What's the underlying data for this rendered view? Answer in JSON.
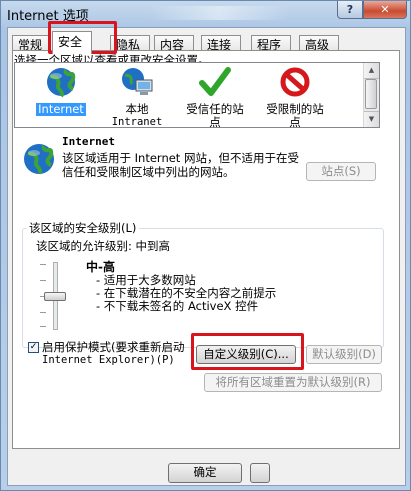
{
  "window": {
    "title": "Internet 选项",
    "help_glyph": "?",
    "close_glyph": "✕"
  },
  "tabs": [
    {
      "label": "常规",
      "active": false
    },
    {
      "label": "安全",
      "active": true
    },
    {
      "label": "隐私",
      "active": false
    },
    {
      "label": "内容",
      "active": false
    },
    {
      "label": "连接",
      "active": false
    },
    {
      "label": "程序",
      "active": false
    },
    {
      "label": "高级",
      "active": false
    }
  ],
  "security": {
    "prompt": "选择一个区域以查看或更改安全设置。",
    "zones": [
      {
        "label": "Internet",
        "sub": "",
        "icon": "globe-icon",
        "selected": true
      },
      {
        "label": "本地",
        "sub": "Intranet",
        "icon": "local-intranet-icon",
        "selected": false
      },
      {
        "label": "受信任的站",
        "sub": "点",
        "icon": "trusted-checkmark-icon",
        "selected": false
      },
      {
        "label": "受限制的站",
        "sub": "点",
        "icon": "restricted-no-icon",
        "selected": false
      }
    ],
    "zone_name": "Internet",
    "zone_desc": "该区域适用于 Internet 网站，但不适用于在受信任和受限制区域中列出的网站。",
    "sites_button": "站点(S)",
    "group_label": "该区域的安全级别(L)",
    "allowed_levels": "该区域的允许级别: 中到高",
    "level_name": "中-高",
    "bullets": [
      "- 适用于大多数网站",
      "- 在下载潜在的不安全内容之前提示",
      "- 不下载未签名的 ActiveX 控件"
    ],
    "protected_mode_line1": "启用保护模式(要求重新启动",
    "protected_mode_line2": "Internet Explorer)(P)",
    "protected_mode_checked": true,
    "custom_level_button": "自定义级别(C)...",
    "default_level_button": "默认级别(D)",
    "reset_all_button": "将所有区域重置为默认级别(R)"
  },
  "footer": {
    "ok_button": "确定"
  },
  "colors": {
    "highlight": "#d9141c",
    "selection": "#3399ff",
    "window_frame": "#b9d1ea"
  }
}
